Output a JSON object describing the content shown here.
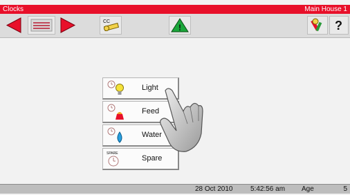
{
  "title_bar": {
    "left": "Clocks",
    "right": "Main House 1",
    "color": "#e8102a"
  },
  "toolbar": {
    "buttons": [
      {
        "icon": "arrow-left-icon"
      },
      {
        "icon": "list-panel-icon"
      },
      {
        "icon": "arrow-right-icon"
      },
      {
        "icon": "cc-key-icon",
        "text": "CC"
      },
      {
        "icon": "warning-triangle-icon",
        "text": "!"
      },
      {
        "icon": "keys-icon"
      },
      {
        "icon": "help-icon",
        "text": "?"
      }
    ]
  },
  "menu": {
    "items": [
      {
        "label": "Light",
        "icon": "light-bulb-clock-icon"
      },
      {
        "label": "Feed",
        "icon": "feed-clock-icon"
      },
      {
        "label": "Water",
        "icon": "water-drop-clock-icon"
      },
      {
        "label": "Spare",
        "icon": "spare-clock-icon",
        "badge": "SPARE"
      }
    ]
  },
  "status_bar": {
    "date": "28 Oct 2010",
    "time": "5:42:56 am",
    "age_label": "Age",
    "age_value": "5"
  }
}
